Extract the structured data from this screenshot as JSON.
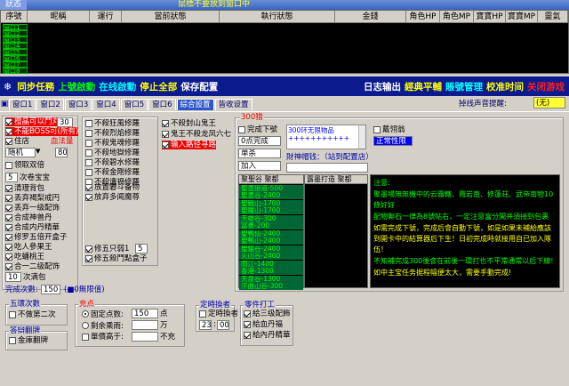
{
  "title": {
    "status_tab": "狀态",
    "window_title": "鼠標不要放到窗口中"
  },
  "grid": {
    "columns": [
      "序號",
      "昵稱",
      "運行",
      "當前狀態",
      "執行狀態",
      "金錢",
      "角色HP",
      "角色MP",
      "寶寶HP",
      "寶寶MP",
      "靈氣"
    ],
    "rows": [
      "窗口1",
      "窗口2",
      "窗口3",
      "窗口4",
      "窗口5",
      "窗口6",
      "窗口7",
      "窗口8"
    ]
  },
  "toolbar": {
    "left": [
      {
        "label": "同步任務",
        "color": "#ffff00"
      },
      {
        "label": "上號啟動",
        "color": "#00ff00"
      },
      {
        "label": "在线啟動",
        "color": "#00ffff"
      },
      {
        "label": "停止全部",
        "color": "#ffff00"
      },
      {
        "label": "保存配置",
        "color": "#ffffff"
      }
    ],
    "right": [
      {
        "label": "日志输出",
        "color": "#ffffff"
      },
      {
        "label": "經典平輔",
        "color": "#ffff00"
      },
      {
        "label": "賬號管理",
        "color": "#00ffff"
      },
      {
        "label": "校准时间",
        "color": "#ffff00"
      },
      {
        "label": "关闭游戏",
        "color": "#ff2020"
      }
    ]
  },
  "tabs": [
    "窗口1",
    "窗口2",
    "窗口3",
    "窗口4",
    "窗口5",
    "窗口6",
    "綜合設置",
    "皆收设置"
  ],
  "skin": {
    "label": "掉线声音提醒:",
    "value": "(无)"
  },
  "col1": {
    "items": [
      {
        "label": "橙晶可以鬥丸",
        "checked": true,
        "red": true
      },
      {
        "label": "不能BOSS可(所有)",
        "checked": true,
        "red": true
      },
      {
        "label": "住店",
        "checked": true
      },
      {
        "label": "领取双倍",
        "checked": false
      },
      {
        "label": "清理背包",
        "checked": true
      },
      {
        "label": "丢弃褐梨戒円",
        "checked": true
      },
      {
        "label": "丢弃一级配饰",
        "checked": true
      },
      {
        "label": "合成神兽丹",
        "checked": true
      },
      {
        "label": "合成内丹精華",
        "checked": true
      },
      {
        "label": "修罗五倍开盒子",
        "checked": true
      },
      {
        "label": "吃人參果王",
        "checked": true
      },
      {
        "label": "吃蟠桃王",
        "checked": true
      },
      {
        "label": "合一二级配饰",
        "checked": true
      }
    ],
    "f30": "30",
    "f80": "80",
    "blood": "血法量",
    "mode": "随机",
    "bao_num": "5",
    "bao_lbl": "次卷宝宝",
    "loop_num": "10",
    "loop_lbl": "次满包",
    "done_lbl": "完成次數:",
    "done_num": "150",
    "done_hint": "(■0無限值)"
  },
  "col2": {
    "items": [
      {
        "label": "不殺狂風修羅",
        "checked": false
      },
      {
        "label": "不殺烈焰修羅",
        "checked": false
      },
      {
        "label": "不殺鬼魂修羅",
        "checked": false
      },
      {
        "label": "不殺地獄修羅",
        "checked": false
      },
      {
        "label": "不殺碧水修羅",
        "checked": false
      },
      {
        "label": "不殺金剛修羅",
        "checked": false
      },
      {
        "label": "不殺遺禍修羅",
        "checked": false
      }
    ],
    "items2": [
      {
        "label": "放置礬斗备物",
        "checked": true
      },
      {
        "label": "放弃多闻魔尊",
        "checked": true
      }
    ],
    "items3": [
      {
        "label": "修五只弱1",
        "checked": true,
        "num": "5"
      },
      {
        "label": "修五殺鬥點盒子",
        "checked": true
      }
    ]
  },
  "col3": {
    "items": [
      {
        "label": "不殺封山鬼王",
        "checked": true
      },
      {
        "label": "鬼王不殺龙凤六七",
        "checked": true
      },
      {
        "label": "输入路径寻路",
        "checked": true,
        "red": true
      }
    ]
  },
  "col4": {
    "group_title": "300猎",
    "done_check": "完成下號",
    "stop_sel": "0点完成",
    "single_sel": "单杀",
    "join_sel": "加入",
    "trash_text": "300环无限物品+++++++++++",
    "wrap_check": "戴翎翁",
    "rank_sel": "正常性限",
    "fortune_lbl": "財神帽钱：（站到配置店）",
    "map_hdr": "聚聖谷 聚都",
    "drop_hdr": "露墨打造 聚都",
    "maps": [
      "聖墨狼道-500",
      "聖墨谷-2400",
      "聖戰山-1700",
      "聖魔山-1700",
      "天雄谷-300",
      "富貴-200",
      "聖鴨仙-2400",
      "聖鴨山-2400",
      "聖貓谷-2400",
      "火山谷-2400",
      "雨江-1400",
      "香港-1300",
      "天泉谷-1300",
      "汗曲山谷-300"
    ]
  },
  "help": [
    {
      "text": "注意:",
      "color": "#00ff00"
    },
    {
      "text": "聚墨場無無機中的云霧轄、霞岩南、修蓮荘、武帝南物10條好好",
      "color": "#00ff00"
    },
    {
      "text": "配物聯石一律為8號帖右，一定注意富分開并須接到包裹",
      "color": "#00ff00"
    },
    {
      "text": "如需完成下號，完成后會自動下號，如是如果未補給應該到開卡中的結算器后下生！日初完成時就接用自已加入隊伍！",
      "color": "#ffff00"
    },
    {
      "text": "不知補完成300後會在前後一環打也不平常通常以后下線!",
      "color": "#00ff00"
    },
    {
      "text": "如中主宝任务据程幅便太大，需要手動完成!",
      "color": "#ffff00"
    }
  ],
  "bottom": {
    "g1_title": "五環次數",
    "g1_check": "不做第二次",
    "g2_title": "答辯翻牌",
    "g2_check": "金庫翻牌",
    "g3_title": "充点",
    "r1": "固定点数:",
    "r1v": "150",
    "r1u": "点",
    "r2": "剩余乘雨:",
    "r2u": "万",
    "r3": "單價高于:",
    "r3u": "不充",
    "g4_title": "定時換者",
    "g4_check": "定時換者",
    "h": "23",
    "m": "00",
    "g5_title": "零件打工",
    "g5_items": [
      {
        "label": "給三级配飾",
        "checked": true
      },
      {
        "label": "給血丹福",
        "checked": true
      },
      {
        "label": "給內丹精華",
        "checked": true
      }
    ]
  }
}
